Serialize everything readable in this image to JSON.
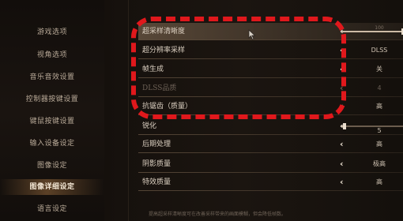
{
  "sidebar": {
    "items": [
      {
        "label": "游戏选项"
      },
      {
        "label": "视角选项"
      },
      {
        "label": "音乐音效设置"
      },
      {
        "label": "控制器按键设置"
      },
      {
        "label": "键鼠按键设置"
      },
      {
        "label": "输入设备设定"
      },
      {
        "label": "图像设定"
      },
      {
        "label": "图像详细设定",
        "active": true
      },
      {
        "label": "语言设定"
      }
    ]
  },
  "settings": {
    "rows": [
      {
        "label": "超采样清晰度",
        "value": "100",
        "control": "slider",
        "slider_fraction": 1.0,
        "highlighted": true
      },
      {
        "label": "超分辨率采样",
        "value": "DLSS"
      },
      {
        "label": "帧生成",
        "value": "关"
      },
      {
        "label": "DLSS品质",
        "value": "4",
        "disabled": true
      },
      {
        "label": "抗锯齿（质量）",
        "value": "高"
      },
      {
        "label": "锐化",
        "value": "5",
        "control": "slider",
        "slider_fraction": 0.05
      },
      {
        "label": "后期处理",
        "value": "高"
      },
      {
        "label": "阴影质量",
        "value": "极高"
      },
      {
        "label": "特效质量",
        "value": "高"
      }
    ],
    "chevron": "‹"
  },
  "description": "提高超采样清晰度可在改善采样带来的画面模糊，但会降低帧数。",
  "colors": {
    "annotation": "#e0181c",
    "active_highlight": "#9a6a3c",
    "row_highlight": "#6e5a46"
  },
  "icons": {
    "cursor": "pointer-arrow-icon",
    "chevron": "chevron-left-icon"
  }
}
